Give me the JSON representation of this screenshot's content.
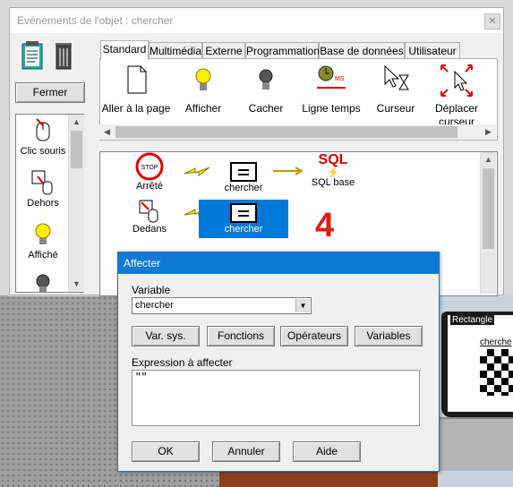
{
  "window": {
    "title": "Evénements de l'objet : chercher",
    "close_glyph": "✕"
  },
  "left_panel": {
    "close_button": "Fermer",
    "events": [
      {
        "label": "Clic souris",
        "icon": "mouse-click-icon"
      },
      {
        "label": "Dehors",
        "icon": "mouse-out-icon"
      },
      {
        "label": "Affiché",
        "icon": "bulb-on-icon"
      },
      {
        "label": "",
        "icon": "bulb-off-icon"
      }
    ]
  },
  "tabs": [
    "Standard",
    "Multimédia",
    "Externe",
    "Programmation",
    "Base de données",
    "Utilisateur"
  ],
  "active_tab": "Standard",
  "tools": [
    {
      "label": "Aller à la page",
      "icon": "page-icon"
    },
    {
      "label": "Afficher",
      "icon": "bulb-on-icon"
    },
    {
      "label": "Cacher",
      "icon": "bulb-off-icon"
    },
    {
      "label": "Ligne temps",
      "icon": "timeline-icon",
      "badge": "MS"
    },
    {
      "label": "Curseur",
      "icon": "cursor-hourglass-icon"
    },
    {
      "label": "Déplacer curseur",
      "icon": "move-cursor-icon"
    }
  ],
  "canvas": {
    "row1": {
      "event": "Arrêté",
      "event_icon_text": "STOP",
      "target": "chercher",
      "action": "SQL base",
      "action_icon_text": "SQL"
    },
    "row2": {
      "event": "Dedans",
      "target": "chercher"
    },
    "step_number": "4"
  },
  "background": {
    "rect_label": "Rectangle",
    "monitor_text": "cherche"
  },
  "dialog": {
    "title": "Affecter",
    "variable_label": "Variable",
    "variable_value": "chercher",
    "buttons": [
      "Var. sys.",
      "Fonctions",
      "Opérateurs",
      "Variables"
    ],
    "expression_label": "Expression à affecter",
    "expression_value": "\"\"",
    "ok": "OK",
    "cancel": "Annuler",
    "help": "Aide"
  },
  "colors": {
    "accent": "#0f7ad6",
    "selection": "#0078d7",
    "step_number": "#e8170f",
    "sql_text": "#cc0000"
  }
}
